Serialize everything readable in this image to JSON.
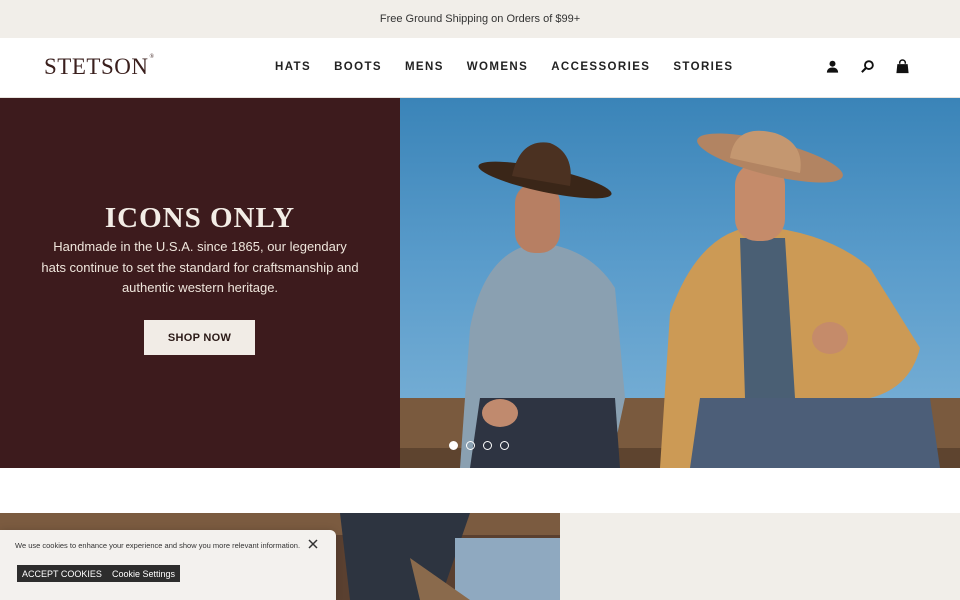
{
  "promo": {
    "text": "Free Ground Shipping on Orders of $99+"
  },
  "header": {
    "logo": "STETSON",
    "nav": [
      "HATS",
      "BOOTS",
      "MENS",
      "WOMENS",
      "ACCESSORIES",
      "STORIES"
    ],
    "icons": [
      "account-icon",
      "search-icon",
      "bag-icon"
    ]
  },
  "hero": {
    "title": "ICONS ONLY",
    "copy": "Handmade in the U.S.A. since 1865, our legendary hats continue to set the standard for craftsmanship and authentic western heritage.",
    "cta": "SHOP NOW",
    "slides_total": 4,
    "active_slide": 1,
    "image": "two-cowboys-on-fence-photo"
  },
  "second": {
    "image": "cowboy-boots-on-fence-photo"
  },
  "cookie": {
    "text": "We use cookies to enhance your experience and show you more relevant information.",
    "accept": "ACCEPT COOKIES",
    "settings": "Cookie Settings"
  },
  "colors": {
    "brand_maroon": "#3d1b1d",
    "promo_bg": "#f1eee9",
    "sky": "#5a9ccb"
  }
}
